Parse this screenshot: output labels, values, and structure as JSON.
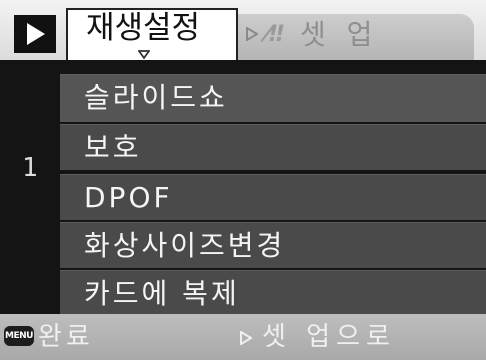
{
  "header": {
    "mode_icon": "play-icon",
    "active_tab_label": "재생설정",
    "inactive_tab_icon": "wrench-icon",
    "inactive_tab_icon_glyph": "⁄‼",
    "inactive_tab_label": "셋 업"
  },
  "page": {
    "number": "1"
  },
  "menu": {
    "items": [
      {
        "label": "슬라이드쇼"
      },
      {
        "label": "보호"
      },
      {
        "label": "DPOF"
      },
      {
        "label": "화상사이즈변경"
      },
      {
        "label": "카드에 복제"
      }
    ]
  },
  "footer": {
    "menu_key_label": "MENU",
    "done_label": "완료",
    "next_icon": "triangle-right-icon",
    "next_label": "셋 업으로"
  },
  "colors": {
    "background": "#141414",
    "menu_item_bg": "#4a4a4a",
    "tab_active_bg": "#ffffff",
    "tab_inactive_bg": "#c2c2c2",
    "footer_bg": "#b3b3b3"
  }
}
